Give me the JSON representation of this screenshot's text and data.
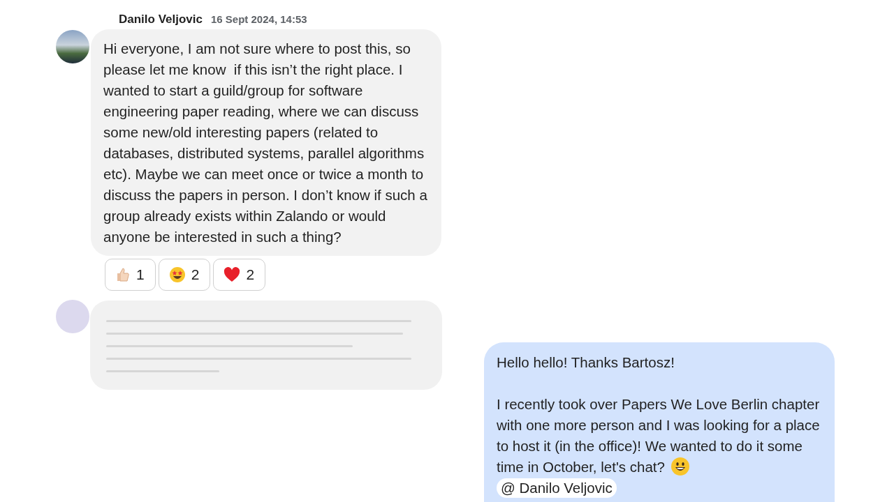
{
  "messages": [
    {
      "kind": "post",
      "author": "Danilo Veljovic",
      "time": "16 Sept 2024, 14:53",
      "text": "Hi everyone, I am not sure where to post this, so please let me know  if this isn’t the right place. I wanted to start a guild/group for software engineering paper reading, where we can discuss some new/old interesting papers (related to databases, distributed systems, parallel algorithms etc). Maybe we can meet once or twice a month to discuss the papers in person. I don’t know if such a group already exists within Zalando or would anyone be interested in such a thing?",
      "reactions": [
        {
          "kind": "thumbs",
          "count": "1"
        },
        {
          "kind": "star-eyes",
          "count": "2"
        },
        {
          "kind": "heart",
          "count": "2"
        }
      ]
    },
    {
      "kind": "hidden"
    },
    {
      "kind": "own",
      "paragraphs": [
        "Hello hello! Thanks Bartosz!",
        "I recently took over Papers We Love Berlin chapter with one more person and I was looking for a place to host it (in the office)! We wanted to do it some time in October, let's chat?"
      ],
      "mention": "@ Danilo Veljovic"
    }
  ]
}
